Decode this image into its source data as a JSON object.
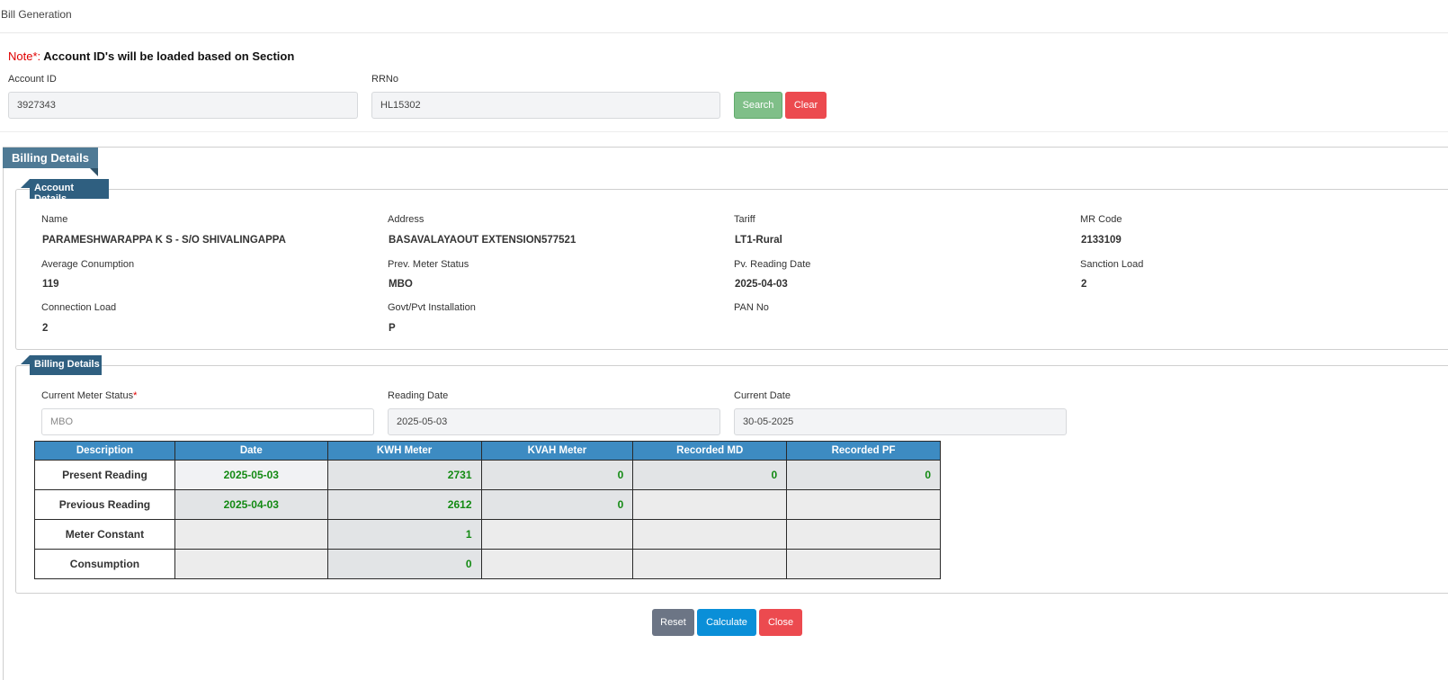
{
  "header": {
    "title": "Bill Generation"
  },
  "note": {
    "label": "Note*:",
    "text": "Account ID's will be loaded based on Section"
  },
  "search": {
    "account_id_label": "Account ID",
    "account_id_value": "3927343",
    "rrno_label": "RRNo",
    "rrno_value": "HL15302",
    "search_label": "Search",
    "clear_label": "Clear"
  },
  "billing_panel": {
    "title": "Billing Details"
  },
  "account_details": {
    "title": "Account Details",
    "fields": [
      {
        "label": "Name",
        "value": "PARAMESHWARAPPA K S - S/O SHIVALINGAPPA"
      },
      {
        "label": "Address",
        "value": "BASAVALAYAOUT EXTENSION577521"
      },
      {
        "label": "Tariff",
        "value": "LT1-Rural"
      },
      {
        "label": "MR Code",
        "value": "2133109"
      },
      {
        "label": "Average Conumption",
        "value": "119"
      },
      {
        "label": "Prev. Meter Status",
        "value": "MBO"
      },
      {
        "label": "Pv. Reading Date",
        "value": "2025-04-03"
      },
      {
        "label": "Sanction Load",
        "value": "2"
      },
      {
        "label": "Connection Load",
        "value": "2"
      },
      {
        "label": "Govt/Pvt Installation",
        "value": "P"
      },
      {
        "label": "PAN No",
        "value": ""
      }
    ]
  },
  "billing_details": {
    "title": "Billing Details",
    "meter_status_label": "Current Meter Status",
    "meter_status_required": "*",
    "meter_status_value": "MBO",
    "reading_date_label": "Reading Date",
    "reading_date_value": "2025-05-03",
    "current_date_label": "Current Date",
    "current_date_value": "30-05-2025"
  },
  "table": {
    "headers": [
      "Description",
      "Date",
      "KWH Meter",
      "KVAH Meter",
      "Recorded MD",
      "Recorded PF"
    ],
    "rows": [
      [
        "Present Reading",
        "2025-05-03",
        "2731",
        "0",
        "0",
        "0"
      ],
      [
        "Previous Reading",
        "2025-04-03",
        "2612",
        "0",
        "",
        ""
      ],
      [
        "Meter Constant",
        "",
        "1",
        "",
        "",
        ""
      ],
      [
        "Consumption",
        "",
        "0",
        "",
        "",
        ""
      ]
    ]
  },
  "actions": {
    "reset_label": "Reset",
    "calculate_label": "Calculate",
    "close_label": "Close"
  }
}
